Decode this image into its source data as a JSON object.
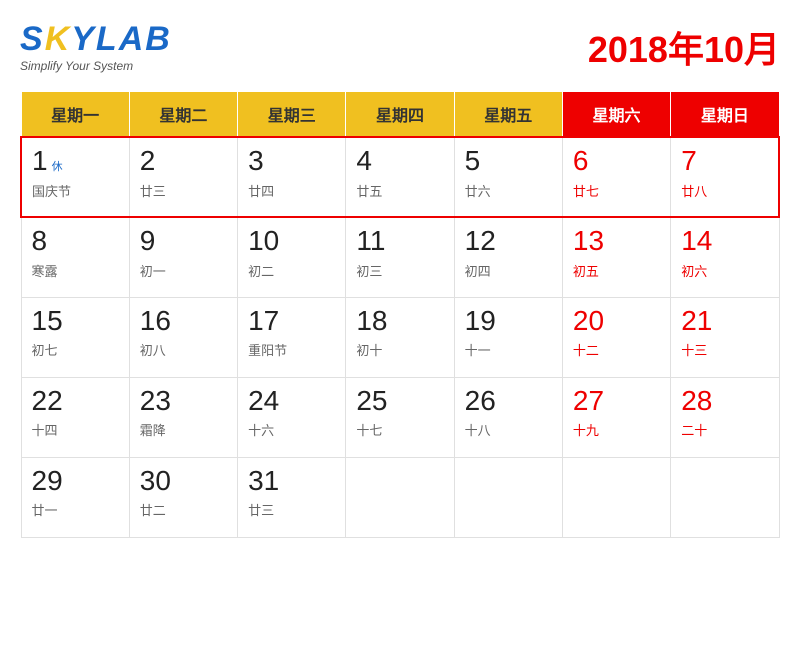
{
  "header": {
    "logo_sky": "SKY",
    "logo_lab": "LAB",
    "logo_subtitle": "Simplify Your System",
    "month_title": "2018年10月"
  },
  "weekdays": [
    {
      "label": "星期一",
      "is_weekend": false
    },
    {
      "label": "星期二",
      "is_weekend": false
    },
    {
      "label": "星期三",
      "is_weekend": false
    },
    {
      "label": "星期四",
      "is_weekend": false
    },
    {
      "label": "星期五",
      "is_weekend": false
    },
    {
      "label": "星期六",
      "is_weekend": true
    },
    {
      "label": "星期日",
      "is_weekend": true
    }
  ],
  "weeks": [
    {
      "golden_week": true,
      "days": [
        {
          "num": "1",
          "sub": "国庆节",
          "rest": "休",
          "is_weekend": false
        },
        {
          "num": "2",
          "sub": "廿三",
          "rest": "",
          "is_weekend": false
        },
        {
          "num": "3",
          "sub": "廿四",
          "rest": "",
          "is_weekend": false
        },
        {
          "num": "4",
          "sub": "廿五",
          "rest": "",
          "is_weekend": false
        },
        {
          "num": "5",
          "sub": "廿六",
          "rest": "",
          "is_weekend": false
        },
        {
          "num": "6",
          "sub": "廿七",
          "rest": "",
          "is_weekend": true
        },
        {
          "num": "7",
          "sub": "廿八",
          "rest": "",
          "is_weekend": true
        }
      ]
    },
    {
      "golden_week": false,
      "days": [
        {
          "num": "8",
          "sub": "寒露",
          "rest": "",
          "is_weekend": false
        },
        {
          "num": "9",
          "sub": "初一",
          "rest": "",
          "is_weekend": false
        },
        {
          "num": "10",
          "sub": "初二",
          "rest": "",
          "is_weekend": false
        },
        {
          "num": "11",
          "sub": "初三",
          "rest": "",
          "is_weekend": false
        },
        {
          "num": "12",
          "sub": "初四",
          "rest": "",
          "is_weekend": false
        },
        {
          "num": "13",
          "sub": "初五",
          "rest": "",
          "is_weekend": true
        },
        {
          "num": "14",
          "sub": "初六",
          "rest": "",
          "is_weekend": true
        }
      ]
    },
    {
      "golden_week": false,
      "days": [
        {
          "num": "15",
          "sub": "初七",
          "rest": "",
          "is_weekend": false
        },
        {
          "num": "16",
          "sub": "初八",
          "rest": "",
          "is_weekend": false
        },
        {
          "num": "17",
          "sub": "重阳节",
          "rest": "",
          "is_weekend": false
        },
        {
          "num": "18",
          "sub": "初十",
          "rest": "",
          "is_weekend": false
        },
        {
          "num": "19",
          "sub": "十一",
          "rest": "",
          "is_weekend": false
        },
        {
          "num": "20",
          "sub": "十二",
          "rest": "",
          "is_weekend": true
        },
        {
          "num": "21",
          "sub": "十三",
          "rest": "",
          "is_weekend": true
        }
      ]
    },
    {
      "golden_week": false,
      "days": [
        {
          "num": "22",
          "sub": "十四",
          "rest": "",
          "is_weekend": false
        },
        {
          "num": "23",
          "sub": "霜降",
          "rest": "",
          "is_weekend": false
        },
        {
          "num": "24",
          "sub": "十六",
          "rest": "",
          "is_weekend": false
        },
        {
          "num": "25",
          "sub": "十七",
          "rest": "",
          "is_weekend": false
        },
        {
          "num": "26",
          "sub": "十八",
          "rest": "",
          "is_weekend": false
        },
        {
          "num": "27",
          "sub": "十九",
          "rest": "",
          "is_weekend": true
        },
        {
          "num": "28",
          "sub": "二十",
          "rest": "",
          "is_weekend": true
        }
      ]
    },
    {
      "golden_week": false,
      "days": [
        {
          "num": "29",
          "sub": "廿一",
          "rest": "",
          "is_weekend": false
        },
        {
          "num": "30",
          "sub": "廿二",
          "rest": "",
          "is_weekend": false
        },
        {
          "num": "31",
          "sub": "廿三",
          "rest": "",
          "is_weekend": false
        },
        null,
        null,
        null,
        null
      ]
    }
  ]
}
